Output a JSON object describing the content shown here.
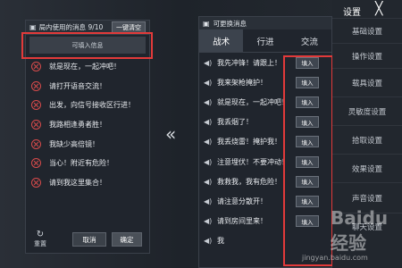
{
  "left_panel": {
    "title": "局内使用的消息 9/10",
    "clear_button": "一键清空",
    "pending_label": "可填入信息",
    "messages": [
      "就是现在，一起冲吧！",
      "请打开语音交流！",
      "出发，向信号接收区行进！",
      "我路相逢勇者胜！",
      "我缺少高倍镜！",
      "当心！附近有危险！",
      "请到我这里集合！"
    ],
    "reset_label": "重置",
    "cancel_button": "取消",
    "confirm_button": "确定"
  },
  "arrow_glyph": "«",
  "right_panel": {
    "title": "可更换消息",
    "tabs": [
      "战术",
      "行进",
      "交流"
    ],
    "messages": [
      "我先冲锋！请跟上！",
      "我来架枪掩护！",
      "就是现在，一起冲吧！",
      "我丢烟了！",
      "我丢烧雷！掩护我！",
      "注意埋伏！不要冲动！",
      "救救我，我有危险！",
      "请注意分散开！",
      "请到房间里来！",
      "我"
    ],
    "fill_button": "填入"
  },
  "settings": {
    "title": "设置",
    "close": "╳",
    "items": [
      "基础设置",
      "操作设置",
      "载具设置",
      "灵敏度设置",
      "拾取设置",
      "效果设置",
      "声音设置",
      "聊天设置"
    ]
  },
  "watermark": "Baidu经验",
  "watermark_url": "jingyan.baidu.com",
  "colors": {
    "highlight": "#e23a3a",
    "x_icon": "#d84b4b"
  }
}
